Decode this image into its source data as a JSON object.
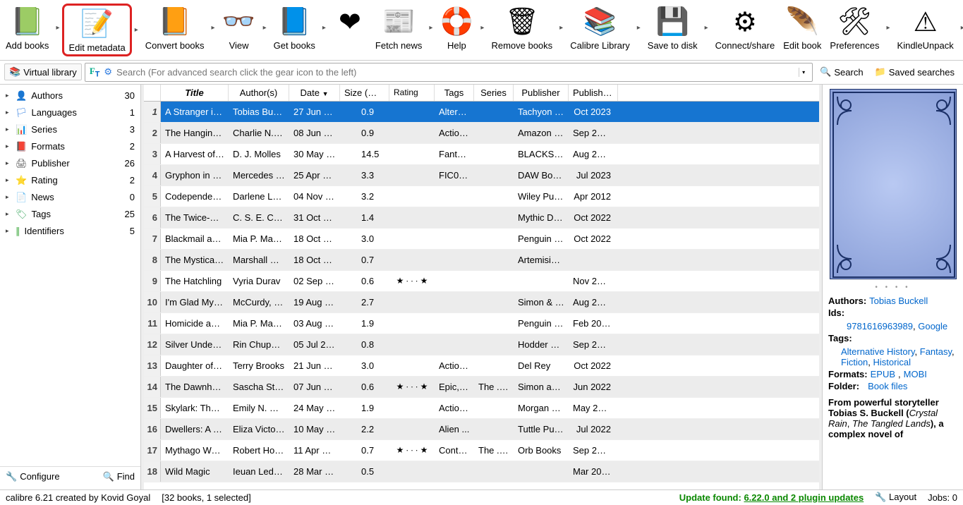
{
  "toolbar": [
    {
      "id": "add-books",
      "label": "Add books",
      "bg": "#3aa63a",
      "fg": "#fff",
      "dd": true
    },
    {
      "id": "edit-metadata",
      "label": "Edit metadata",
      "bg": "#2c7be0",
      "fg": "#fff",
      "dd": true,
      "hl": true
    },
    {
      "id": "convert-books",
      "label": "Convert books",
      "bg": "#8b5a2b",
      "fg": "#fff",
      "dd": true
    },
    {
      "id": "view",
      "label": "View",
      "bg": "#3aa63a",
      "fg": "#000",
      "dd": true
    },
    {
      "id": "get-books",
      "label": "Get books",
      "bg": "#2c7be0",
      "fg": "#fff",
      "dd": true,
      "sp": true
    },
    {
      "id": "heart",
      "label": "",
      "bg": "#e01b24",
      "fg": "#fff"
    },
    {
      "id": "fetch-news",
      "label": "Fetch news",
      "bg": "#888",
      "fg": "#fff",
      "dd": true
    },
    {
      "id": "help",
      "label": "Help",
      "bg": "#f28c1b",
      "fg": "#fff",
      "dd": true
    },
    {
      "id": "remove-books",
      "label": "Remove books",
      "bg": "#c23",
      "fg": "#fff",
      "dd": true
    },
    {
      "id": "calibre-library",
      "label": "Calibre Library",
      "bg": "#6b4a2e",
      "fg": "#fff",
      "dd": true
    },
    {
      "id": "save-disk",
      "label": "Save to disk",
      "bg": "#2c7be0",
      "fg": "#fff",
      "dd": true
    },
    {
      "id": "connect-share",
      "label": "Connect/share",
      "bg": "#777",
      "fg": "#fff"
    },
    {
      "id": "edit-book",
      "label": "Edit book",
      "bg": "#a05",
      "fg": "#fff"
    },
    {
      "id": "preferences",
      "label": "Preferences",
      "bg": "#555",
      "fg": "#fff",
      "dd": true
    },
    {
      "id": "kindle-unpack",
      "label": "KindleUnpack",
      "bg": "#e8b800",
      "fg": "#000",
      "dd": true
    }
  ],
  "searchbar": {
    "vl_label": "Virtual library",
    "placeholder": "Search (For advanced search click the gear icon to the left)",
    "search_label": "Search",
    "saved_label": "Saved searches"
  },
  "sidebar": {
    "items": [
      {
        "id": "authors",
        "label": "Authors",
        "count": 30,
        "color": "#2c7be0"
      },
      {
        "id": "languages",
        "label": "Languages",
        "count": 1,
        "color": "#2c7be0"
      },
      {
        "id": "series",
        "label": "Series",
        "count": 3,
        "color": "#178"
      },
      {
        "id": "formats",
        "label": "Formats",
        "count": 2,
        "color": "#8b5a2b"
      },
      {
        "id": "publisher",
        "label": "Publisher",
        "count": 26,
        "color": "#555"
      },
      {
        "id": "rating",
        "label": "Rating",
        "count": 2,
        "color": "#f4c20d"
      },
      {
        "id": "news",
        "label": "News",
        "count": 0,
        "color": "#888"
      },
      {
        "id": "tags",
        "label": "Tags",
        "count": 25,
        "color": "#4a6"
      },
      {
        "id": "identifiers",
        "label": "Identifiers",
        "count": 5,
        "color": "#3aa63a"
      }
    ],
    "configure": "Configure",
    "find": "Find"
  },
  "columns": [
    "Title",
    "Author(s)",
    "Date",
    "Size (MB)",
    "Rating",
    "Tags",
    "Series",
    "Publisher",
    "Published"
  ],
  "rows": [
    {
      "n": 1,
      "title": "A Stranger in th...",
      "author": "Tobias Buckell",
      "date": "27 Jun 20...",
      "size": "0.9",
      "rating": "",
      "tags": "Altern...",
      "series": "",
      "pub": "Tachyon Pu...",
      "published": "Oct 2023",
      "sel": true
    },
    {
      "n": 2,
      "title": "The Hanging City",
      "author": "Charlie N. Ho...",
      "date": "08 Jun 20...",
      "size": "0.9",
      "rating": "",
      "tags": "Action...",
      "series": "",
      "pub": "Amazon Pu...",
      "published": "Sep 2023"
    },
    {
      "n": 3,
      "title": "A Harvest of As...",
      "author": "D. J. Molles",
      "date": "30 May 2...",
      "size": "14.5",
      "rating": "",
      "tags": "Fantas...",
      "series": "",
      "pub": "BLACKSTO...",
      "published": "Aug 2023"
    },
    {
      "n": 4,
      "title": "Gryphon in Lig...",
      "author": "Mercedes La...",
      "date": "25 Apr 20...",
      "size": "3.3",
      "rating": "",
      "tags": "FIC000...",
      "series": "",
      "pub": "DAW Books",
      "published": "Jul 2023"
    },
    {
      "n": 5,
      "title": "Codependency",
      "author": "Darlene Lanc...",
      "date": "04 Nov 2...",
      "size": "3.2",
      "rating": "",
      "tags": "",
      "series": "",
      "pub": "Wiley Publi...",
      "published": "Apr 2012"
    },
    {
      "n": 6,
      "title": "The Twice-Dro...",
      "author": "C. S. E. Cooney",
      "date": "31 Oct 20...",
      "size": "1.4",
      "rating": "",
      "tags": "",
      "series": "",
      "pub": "Mythic Deli...",
      "published": "Oct 2022"
    },
    {
      "n": 7,
      "title": "Blackmail and ...",
      "author": "Mia P. Mana...",
      "date": "18 Oct 20...",
      "size": "3.0",
      "rating": "",
      "tags": "",
      "series": "",
      "pub": "Penguin Pu...",
      "published": "Oct 2022"
    },
    {
      "n": 8,
      "title": "The Mystical M...",
      "author": "Marshall Rya...",
      "date": "18 Oct 20...",
      "size": "0.7",
      "rating": "",
      "tags": "",
      "series": "",
      "pub": "Artemisia B...",
      "published": ""
    },
    {
      "n": 9,
      "title": "The Hatchling",
      "author": "Vyria Durav",
      "date": "02 Sep 20...",
      "size": "0.6",
      "rating": "★ ∙ ∙ ∙ ★",
      "tags": "",
      "series": "",
      "pub": "",
      "published": "Nov 2021"
    },
    {
      "n": 10,
      "title": "I'm Glad My M...",
      "author": "McCurdy, Je...",
      "date": "19 Aug 2...",
      "size": "2.7",
      "rating": "",
      "tags": "",
      "series": "",
      "pub": "Simon & Sc...",
      "published": "Aug 2022"
    },
    {
      "n": 11,
      "title": "Homicide and ...",
      "author": "Mia P. Mana...",
      "date": "03 Aug 2...",
      "size": "1.9",
      "rating": "",
      "tags": "",
      "series": "",
      "pub": "Penguin Pu...",
      "published": "Feb 2022"
    },
    {
      "n": 12,
      "title": "Silver Under Ni...",
      "author": "Rin Chupeco",
      "date": "05 Jul 2022",
      "size": "0.8",
      "rating": "",
      "tags": "",
      "series": "",
      "pub": "Hodder & S...",
      "published": "Sep 2022"
    },
    {
      "n": 13,
      "title": "Daughter of Da...",
      "author": "Terry Brooks",
      "date": "21 Jun 20...",
      "size": "3.0",
      "rating": "",
      "tags": "Action...",
      "series": "",
      "pub": "Del Rey",
      "published": "Oct 2022"
    },
    {
      "n": 14,
      "title": "The Dawnhounds",
      "author": "Sascha Stron...",
      "date": "07 Jun 20...",
      "size": "0.6",
      "rating": "★ ∙ ∙ ∙ ★",
      "tags": "Epic, F...",
      "series": "The ... [1]",
      "pub": "Simon and ...",
      "published": "Jun 2022"
    },
    {
      "n": 15,
      "title": "Skylark: The Dr...",
      "author": "Emily N. Mad...",
      "date": "24 May 2...",
      "size": "1.9",
      "rating": "",
      "tags": "Action...",
      "series": "",
      "pub": "Morgan Ja...",
      "published": "May 2022"
    },
    {
      "n": 16,
      "title": "Dwellers: A No...",
      "author": "Eliza Victoria",
      "date": "10 May 2...",
      "size": "2.2",
      "rating": "",
      "tags": "Alien ...",
      "series": "",
      "pub": "Tuttle Publi...",
      "published": "Jul 2022"
    },
    {
      "n": 17,
      "title": "Mythago Wood",
      "author": "Robert Holds...",
      "date": "11 Apr 20...",
      "size": "0.7",
      "rating": "★ ∙ ∙ ∙ ★",
      "tags": "Conte...",
      "series": "The ... [1]",
      "pub": "Orb Books",
      "published": "Sep 2003"
    },
    {
      "n": 18,
      "title": "Wild Magic",
      "author": "Ieuan Ledger",
      "date": "28 Mar 2...",
      "size": "0.5",
      "rating": "",
      "tags": "",
      "series": "",
      "pub": "",
      "published": "Mar 2022"
    }
  ],
  "detail": {
    "authors_label": "Authors:",
    "authors": "Tobias Buckell",
    "ids_label": "Ids:",
    "ids": [
      "9781616963989",
      "Google"
    ],
    "tags_label": "Tags:",
    "tags": [
      "Alternative History",
      "Fantasy",
      "Fiction",
      "Historical"
    ],
    "formats_label": "Formats:",
    "formats": [
      "EPUB",
      "MOBI"
    ],
    "folder_label": "Folder:",
    "folder": "Book files",
    "desc1": "From powerful storyteller Tobias S. Buckell (",
    "desc_it1": "Crystal Rain",
    "desc_mid": ", ",
    "desc_it2": "The Tangled Lands",
    "desc2": "), a complex novel of"
  },
  "status": {
    "left1": "calibre 6.21 created by Kovid Goyal",
    "left2": "[32 books, 1 selected]",
    "update_label": "Update found:",
    "update_link": "6.22.0 and 2 plugin updates",
    "layout": "Layout",
    "jobs": "Jobs: 0"
  }
}
